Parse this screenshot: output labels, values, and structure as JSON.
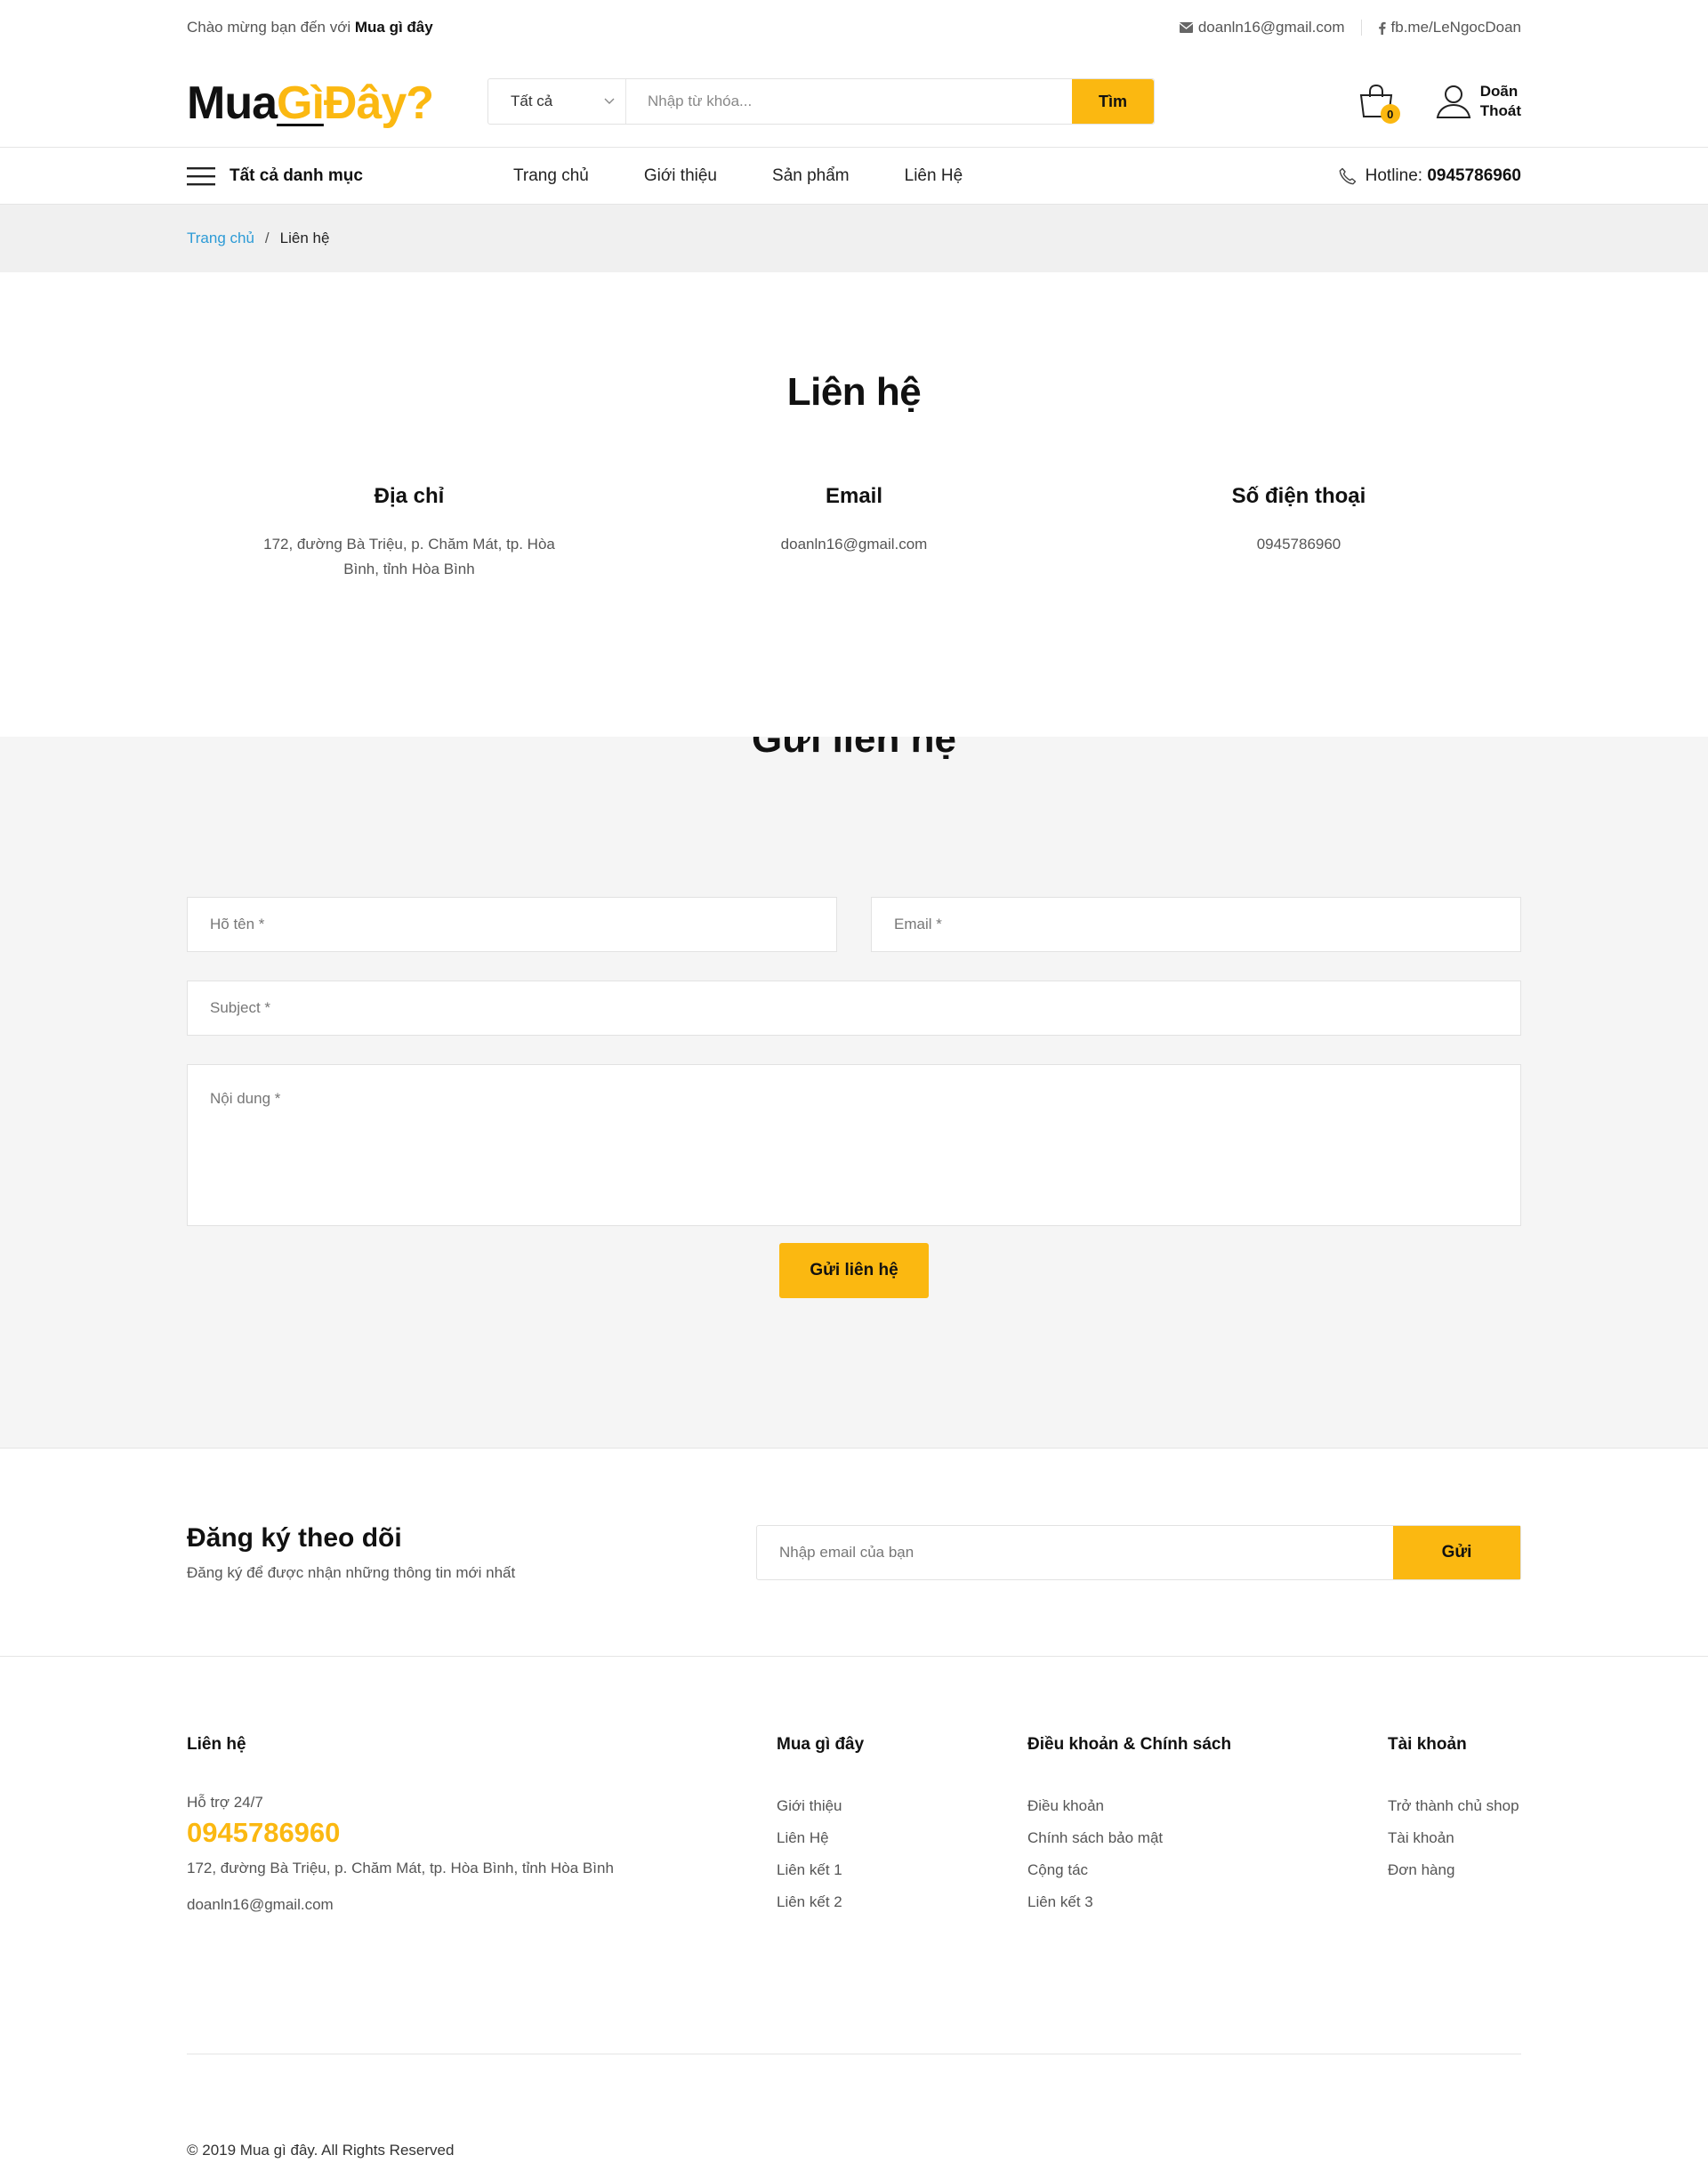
{
  "topbar": {
    "welcome_prefix": "Chào mừng bạn đến với ",
    "welcome_brand": "Mua gì đây",
    "email": "doanln16@gmail.com",
    "facebook": "fb.me/LeNgocDoan"
  },
  "header": {
    "logo_part1": "Mua",
    "logo_part2": "Gì",
    "logo_part3": "Đây?",
    "search_category": "Tất cả",
    "search_placeholder": "Nhập từ khóa...",
    "search_button": "Tìm",
    "cart_count": "0",
    "user_first": "Doãn",
    "user_second": "Thoát"
  },
  "nav": {
    "all_categories": "Tất cả danh mục",
    "items": [
      "Trang chủ",
      "Giới thiệu",
      "Sản phẩm",
      "Liên Hệ"
    ],
    "hotline_label": "Hotline: ",
    "hotline_number": "0945786960"
  },
  "breadcrumb": {
    "home": "Trang chủ",
    "separator": "/",
    "current": "Liên hệ"
  },
  "contact": {
    "title": "Liên hệ",
    "address_title": "Địa chỉ",
    "address_text": "172, đường Bà Triệu, p. Chăm Mát, tp. Hòa Bình, tỉnh Hòa Bình",
    "email_title": "Email",
    "email_text": "doanln16@gmail.com",
    "phone_title": "Số điện thoại",
    "phone_text": "0945786960"
  },
  "form": {
    "title": "Gửi liên hệ",
    "name_placeholder": "Hõ tên *",
    "email_placeholder": "Email *",
    "subject_placeholder": "Subject *",
    "message_placeholder": "Nội dung *",
    "submit": "Gửi liên hệ"
  },
  "newsletter": {
    "title": "Đăng ký theo dõi",
    "subtitle": "Đăng ký để được nhận những thông tin mới nhất",
    "placeholder": "Nhập email của bạn",
    "button": "Gửi"
  },
  "footer": {
    "contact_title": "Liên hệ",
    "support": "Hỗ trợ 24/7",
    "phone": "0945786960",
    "address": "172, đường Bà Triệu, p. Chăm Mát, tp. Hòa Bình, tỉnh Hòa Bình",
    "email": "doanln16@gmail.com",
    "col2_title": "Mua gì đây",
    "col2_items": [
      "Giới thiệu",
      "Liên Hệ",
      "Liên kết 1",
      "Liên kết 2"
    ],
    "col3_title": "Điều khoản & Chính sách",
    "col3_items": [
      "Điều khoản",
      "Chính sách bảo mật",
      "Cộng tác",
      "Liên kết 3"
    ],
    "col4_title": "Tài khoản",
    "col4_items": [
      "Trở thành chủ shop",
      "Tài khoản",
      "Đơn hàng"
    ],
    "copyright": "© 2019 Mua gì đây. All Rights Reserved"
  },
  "colors": {
    "accent": "#fbb811",
    "link": "#2d9bd6",
    "form_bg": "#f5f5f5",
    "breadcrumb_bg": "#f0f0f0"
  },
  "icons": [
    "envelope-icon",
    "facebook-icon",
    "chevron-down-icon",
    "cart-icon",
    "user-icon",
    "hamburger-icon",
    "phone-icon"
  ]
}
